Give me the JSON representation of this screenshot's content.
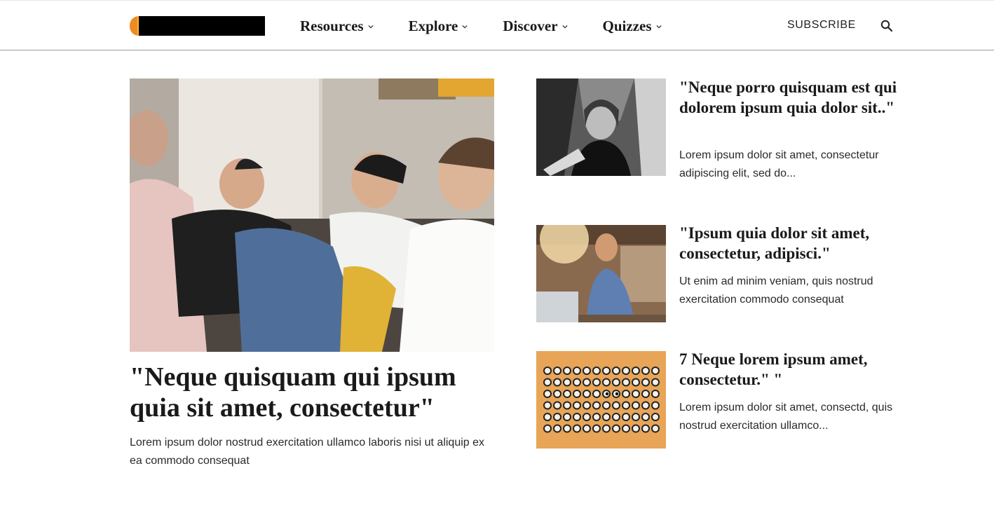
{
  "header": {
    "nav": [
      {
        "label": "Resources"
      },
      {
        "label": "Explore"
      },
      {
        "label": "Discover"
      },
      {
        "label": "Quizzes"
      }
    ],
    "subscribe_label": "SUBSCRIBE",
    "icons": {
      "search": "search-icon",
      "dropdown": "chevron-down-icon"
    }
  },
  "featured": {
    "title": "\"Neque quisquam qui ipsum quia sit amet, consectetur\"",
    "description": "Lorem ipsum dolor nostrud exercitation ullamco laboris nisi ut aliquip ex ea commodo consequat"
  },
  "articles": [
    {
      "title": "\"Neque porro quisquam est qui dolorem ipsum quia dolor sit..\"",
      "description": "Lorem ipsum dolor sit amet, consectetur adipiscing elit, sed do..."
    },
    {
      "title": "\"Ipsum quia dolor sit amet, consectetur, adipisci.\"",
      "description": "Ut enim ad minim veniam, quis nostrud exercitation commodo consequat"
    },
    {
      "title": "7 Neque lorem ipsum amet, consectetur.\" \"",
      "description": "Lorem ipsum dolor sit amet, consectd, quis nostrud exercitation ullamco..."
    }
  ],
  "colors": {
    "logo_orange": "#f08a24",
    "logo_yellow": "#f7b733",
    "tile_orange": "#e8a558",
    "text": "#1a1a1a"
  }
}
